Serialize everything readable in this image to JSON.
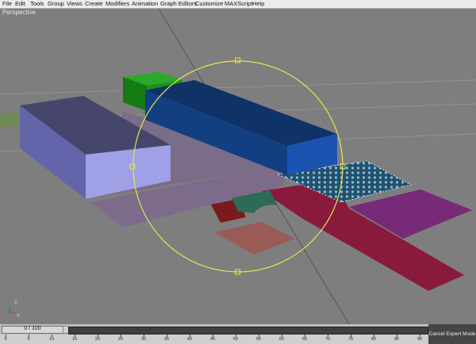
{
  "menu": {
    "items": [
      {
        "label": "File",
        "name": "menu-file"
      },
      {
        "label": "Edit",
        "name": "menu-edit"
      },
      {
        "label": "Tools",
        "name": "menu-tools"
      },
      {
        "label": "Group",
        "name": "menu-group"
      },
      {
        "label": "Views",
        "name": "menu-views"
      },
      {
        "label": "Create",
        "name": "menu-create"
      },
      {
        "label": "Modifiers",
        "name": "menu-modifiers"
      },
      {
        "label": "Animation",
        "name": "menu-animation"
      },
      {
        "label": "Graph Editors",
        "name": "menu-graph-editors"
      },
      {
        "label": "Customize",
        "name": "menu-customize"
      },
      {
        "label": "MAXScript",
        "name": "menu-maxscript"
      },
      {
        "label": "Help",
        "name": "menu-help"
      }
    ]
  },
  "viewport": {
    "label": "Perspective",
    "axis_icon": "axis-tripod-icon",
    "colors": {
      "background": "#7e7e7e",
      "grid": "#9a9a9a",
      "gizmo": "#e6e64a",
      "box_blue": "#174596",
      "box_green": "#1e8a1e",
      "box_lavender": "#9a9ae0",
      "plane_purple": "#8a2a8a",
      "plane_maroon": "#8a1a3a"
    }
  },
  "timeline": {
    "value": "0 / 100",
    "ticks": [
      "0",
      "5",
      "10",
      "15",
      "20",
      "25",
      "30",
      "35",
      "40",
      "45",
      "50",
      "55",
      "60",
      "65",
      "70",
      "75",
      "80",
      "85",
      "90"
    ]
  },
  "status": {
    "expert_mode_button": "Cancel Expert Mode"
  }
}
